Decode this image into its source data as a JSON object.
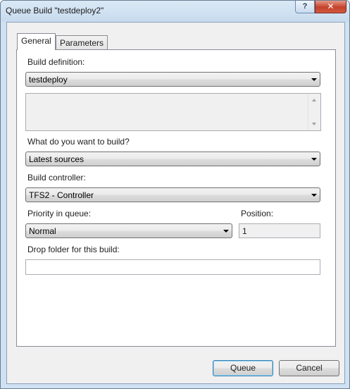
{
  "window": {
    "title": "Queue Build \"testdeploy2\"",
    "help_glyph": "?",
    "close_glyph": "✕"
  },
  "tabs": [
    {
      "label": "General",
      "selected": true
    },
    {
      "label": "Parameters",
      "selected": false
    }
  ],
  "general": {
    "build_definition_label": "Build definition:",
    "build_definition_value": "testdeploy",
    "build_definition_description": "",
    "what_to_build_label": "What do you want to build?",
    "what_to_build_value": "Latest sources",
    "build_controller_label": "Build controller:",
    "build_controller_value": "TFS2 - Controller",
    "priority_label": "Priority in queue:",
    "priority_value": "Normal",
    "position_label": "Position:",
    "position_value": "1",
    "drop_folder_label": "Drop folder for this build:",
    "drop_folder_value": ""
  },
  "buttons": {
    "queue": "Queue",
    "cancel": "Cancel"
  }
}
